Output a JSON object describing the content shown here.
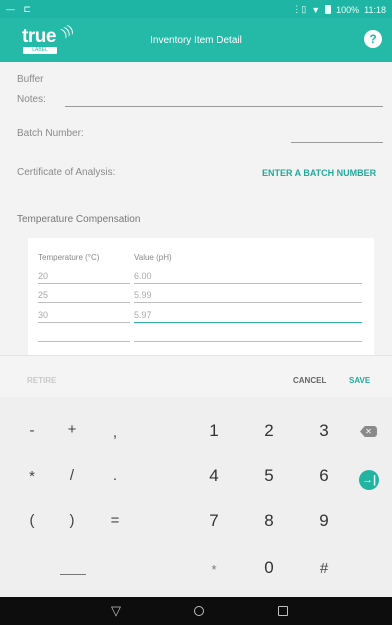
{
  "status_bar": {
    "time": "11:18",
    "battery": "100%"
  },
  "app": {
    "logo_text": "true",
    "logo_tag": "LABEL",
    "title": "Inventory Item Detail",
    "help_label": "?"
  },
  "form": {
    "section_label": "Buffer",
    "notes_label": "Notes:",
    "notes_value": "",
    "batch_label": "Batch Number:",
    "batch_value": "",
    "coa_label": "Certificate of Analysis:",
    "coa_link": "ENTER A BATCH NUMBER",
    "temp_section_title": "Temperature Compensation",
    "table": {
      "headers": [
        "Temperature (°C)",
        "Value (pH)"
      ],
      "rows": [
        {
          "temperature": "20",
          "value": "6.00"
        },
        {
          "temperature": "25",
          "value": "5.99"
        },
        {
          "temperature": "30",
          "value": "5.97"
        },
        {
          "temperature": "",
          "value": ""
        }
      ]
    }
  },
  "actions": {
    "retire": "RETIRE",
    "cancel": "CANCEL",
    "save": "SAVE"
  },
  "keypad": {
    "row1": [
      "-",
      "+",
      ",",
      "1",
      "2",
      "3"
    ],
    "row2": [
      "*",
      "/",
      ".",
      "4",
      "5",
      "6"
    ],
    "row3": [
      "(",
      ")",
      "=",
      "7",
      "8",
      "9"
    ],
    "row4": [
      "*",
      "0",
      "#"
    ],
    "backspace_icon": "backspace-icon",
    "enter_icon": "next-field-icon"
  },
  "colors": {
    "accent": "#25b9a8",
    "status_bar": "#1fb5a4",
    "link": "#23a99a"
  }
}
